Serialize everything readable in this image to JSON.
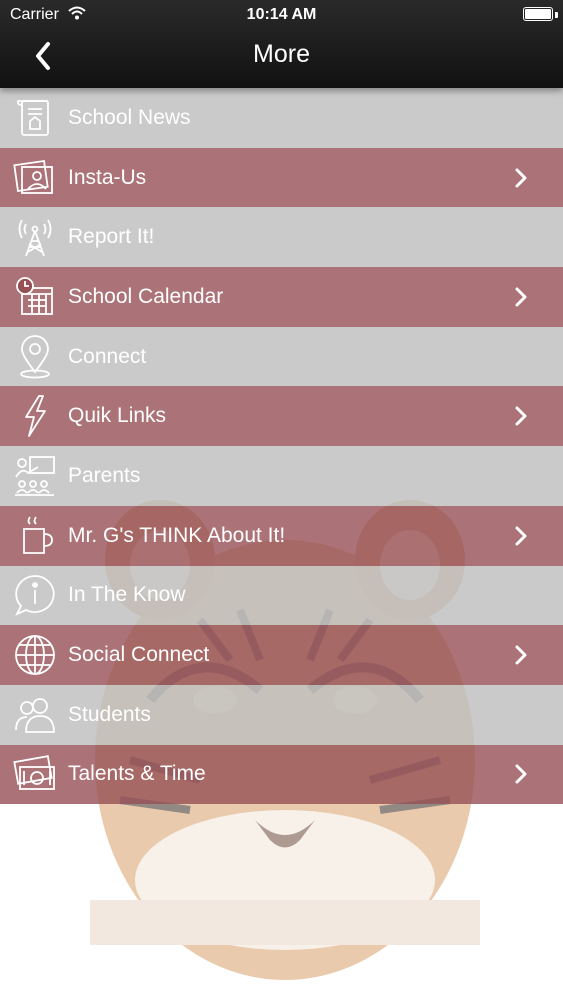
{
  "status_bar": {
    "carrier": "Carrier",
    "time": "10:14 AM"
  },
  "nav": {
    "title": "More"
  },
  "menu": {
    "items": [
      {
        "label": "School News",
        "icon": "scroll-icon",
        "chevron": false
      },
      {
        "label": "Insta-Us",
        "icon": "photos-icon",
        "chevron": true
      },
      {
        "label": "Report It!",
        "icon": "antenna-icon",
        "chevron": false
      },
      {
        "label": "School Calendar",
        "icon": "calendar-icon",
        "chevron": true
      },
      {
        "label": "Connect",
        "icon": "map-pin-icon",
        "chevron": false
      },
      {
        "label": "Quik Links",
        "icon": "lightning-icon",
        "chevron": true
      },
      {
        "label": "Parents",
        "icon": "classroom-icon",
        "chevron": false
      },
      {
        "label": "Mr. G's THINK About It!",
        "icon": "coffee-cup-icon",
        "chevron": true
      },
      {
        "label": "In The Know",
        "icon": "info-bubble-icon",
        "chevron": false
      },
      {
        "label": "Social Connect",
        "icon": "globe-icon",
        "chevron": true
      },
      {
        "label": "Students",
        "icon": "people-icon",
        "chevron": false
      },
      {
        "label": "Talents & Time",
        "icon": "money-icon",
        "chevron": true
      }
    ]
  },
  "colors": {
    "gray_row": "#bebebe",
    "maroon_row": "#965055",
    "bar": "#1a1a1a"
  }
}
